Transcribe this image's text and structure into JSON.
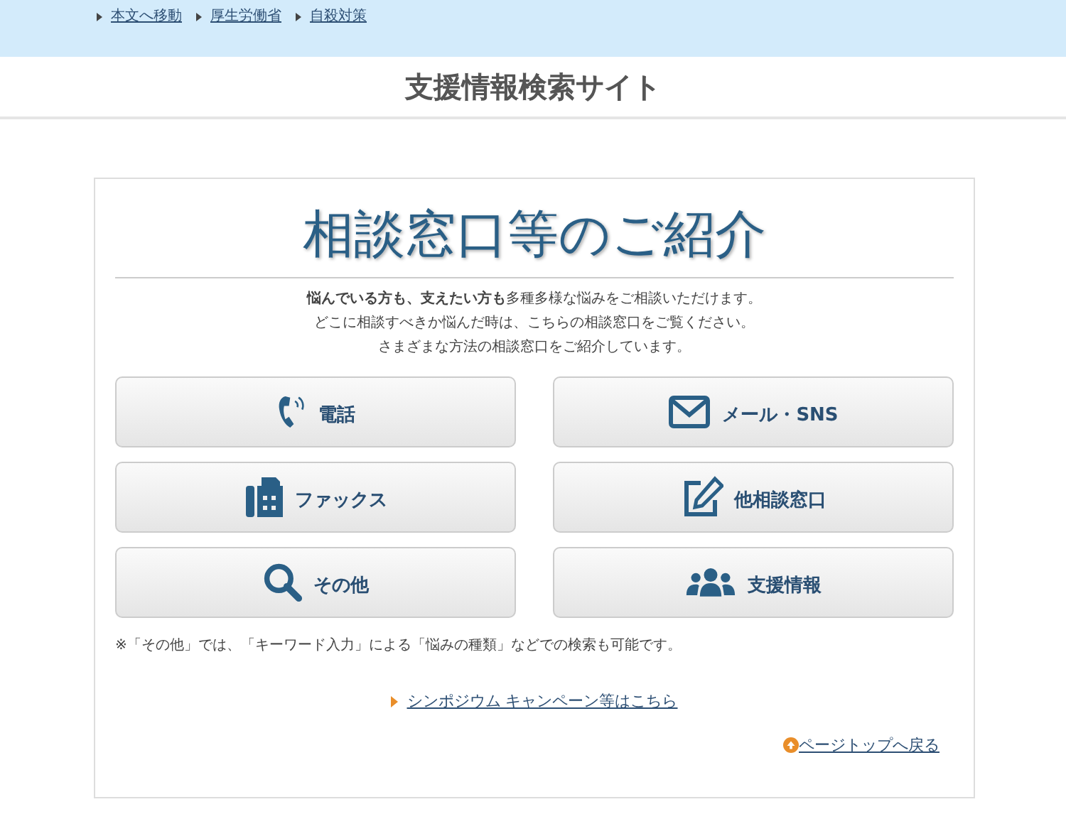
{
  "breadcrumb": [
    "本文へ移動",
    "厚生労働省",
    "自殺対策"
  ],
  "site_title": "支援情報検索サイト",
  "heading": "相談窓口等のご紹介",
  "intro": [
    "**悩んでいる方も、支えたい方も**多種多様な悩みをご相談いただけます。",
    "どこに相談すべきか悩んだ時は、こちらの相談窓口をご覧ください。",
    "さまざまな方法の相談窓口をご紹介しています。"
  ],
  "buttons": [
    {
      "label": "電話",
      "kind": "phone"
    },
    {
      "label": "メール・SNS",
      "kind": "mail"
    },
    {
      "label": "ファックス",
      "kind": "fax"
    },
    {
      "label": "他相談窓口",
      "kind": "edit"
    },
    {
      "label": "その他",
      "kind": "search"
    },
    {
      "label": "支援情報",
      "kind": "people"
    }
  ],
  "note": "※「その他」では、「キーワード入力」による「悩みの種類」などでの検索も可能です。",
  "campaign_link": "シンポジウム キャンペーン等はこちら",
  "page_top_link": "ページトップへ戻る"
}
